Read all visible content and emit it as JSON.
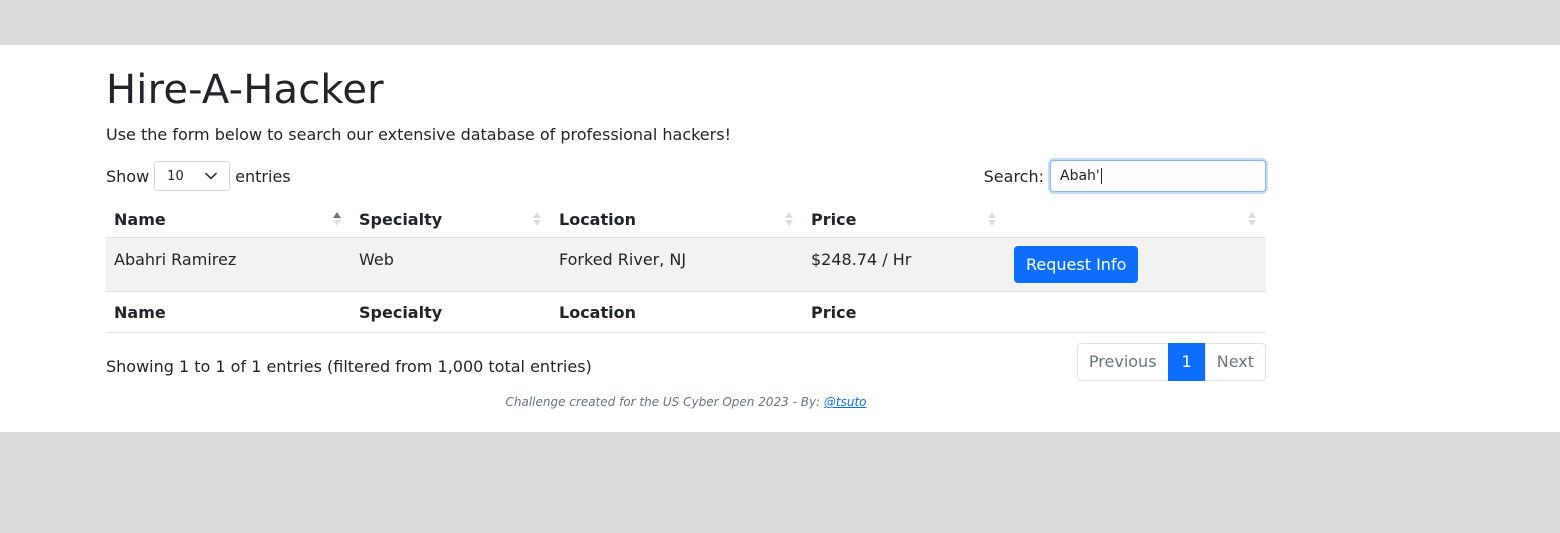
{
  "header": {
    "title": "Hire-A-Hacker",
    "lead": "Use the form below to search our extensive database of professional hackers!"
  },
  "controls": {
    "show_label": "Show",
    "page_size": "10",
    "entries_label": "entries",
    "search_label": "Search:",
    "search_value": "Abah'"
  },
  "table": {
    "columns": [
      "Name",
      "Specialty",
      "Location",
      "Price",
      ""
    ],
    "rows": [
      {
        "name": "Abahri Ramirez",
        "specialty": "Web",
        "location": "Forked River, NJ",
        "price": "$248.74 / Hr",
        "action": "Request Info"
      }
    ],
    "footer_columns": [
      "Name",
      "Specialty",
      "Location",
      "Price",
      ""
    ]
  },
  "info": "Showing 1 to 1 of 1 entries (filtered from 1,000 total entries)",
  "pagination": {
    "previous": "Previous",
    "current": "1",
    "next": "Next"
  },
  "footer": {
    "text": "Challenge created for the US Cyber Open 2023 - By: ",
    "link": "@tsuto"
  },
  "colors": {
    "accent": "#0d6efd",
    "page_bg": "#dcdcdc",
    "row_bg": "#f2f2f2"
  },
  "icons": {
    "sort_active": "sort-asc-icon",
    "sort_inactive": "sort-both-icon",
    "select": "chevron-down-icon"
  }
}
